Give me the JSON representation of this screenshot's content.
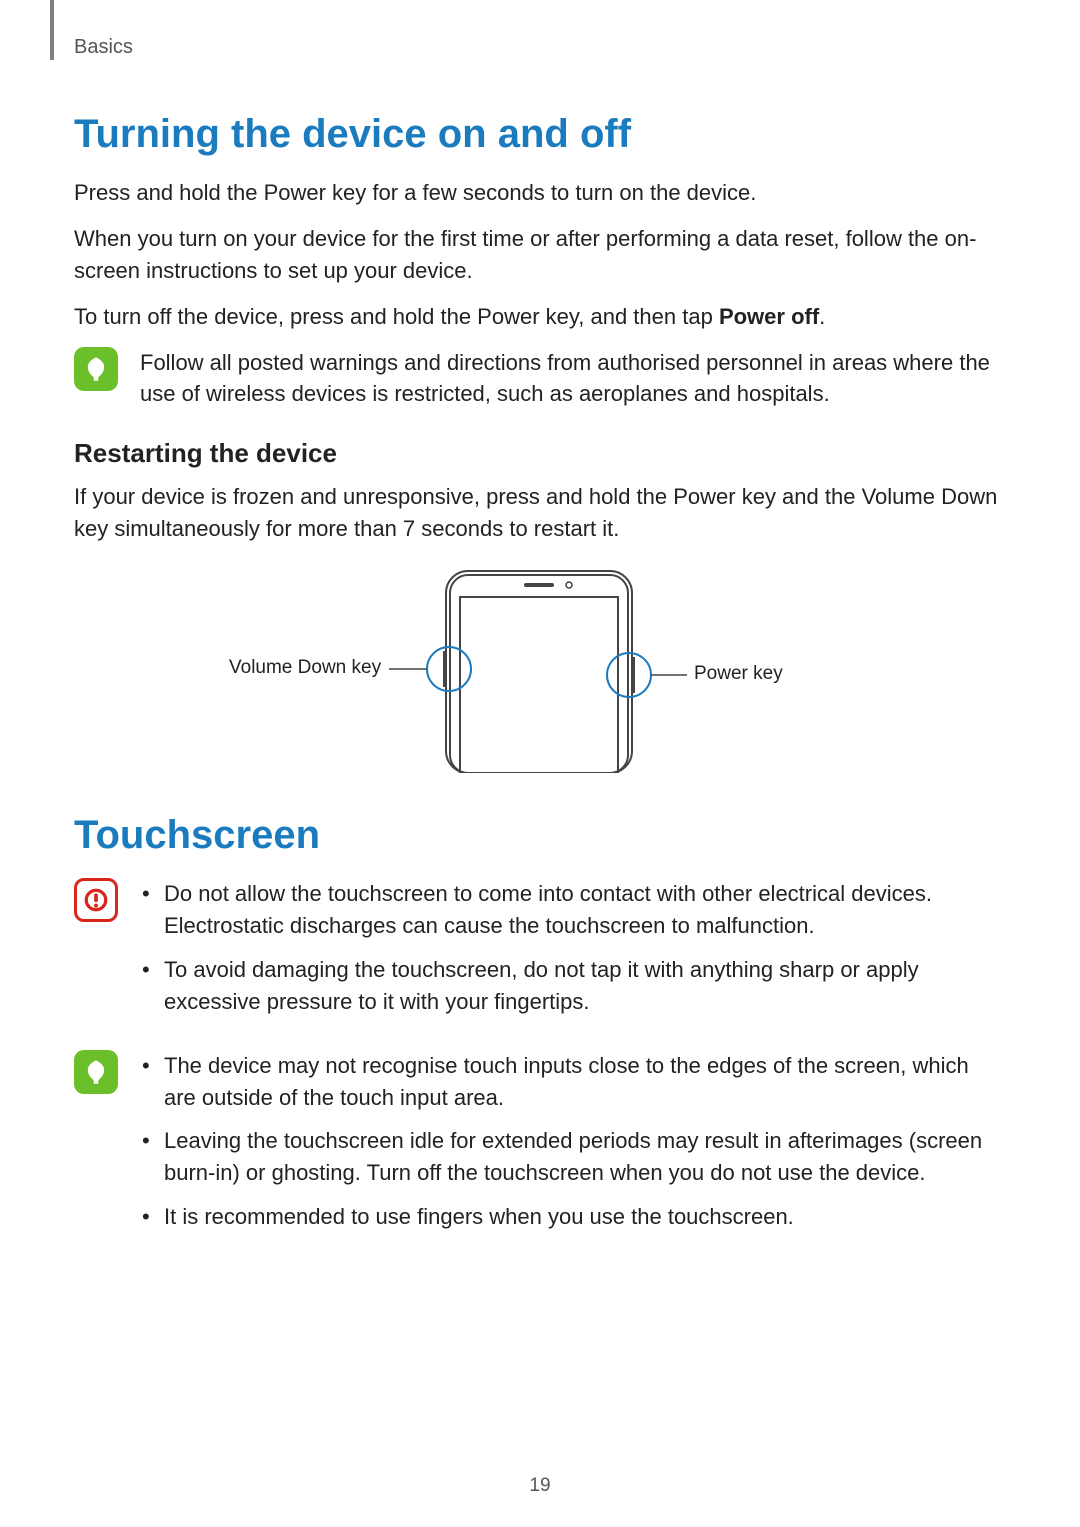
{
  "breadcrumb": "Basics",
  "section1": {
    "heading": "Turning the device on and off",
    "p1": "Press and hold the Power key for a few seconds to turn on the device.",
    "p2": "When you turn on your device for the first time or after performing a data reset, follow the on-screen instructions to set up your device.",
    "p3a": "To turn off the device, press and hold the Power key, and then tap ",
    "p3b_bold": "Power off",
    "p3c": ".",
    "note": "Follow all posted warnings and directions from authorised personnel in areas where the use of wireless devices is restricted, such as aeroplanes and hospitals.",
    "sub_heading": "Restarting the device",
    "sub_p": "If your device is frozen and unresponsive, press and hold the Power key and the Volume Down key simultaneously for more than 7 seconds to restart it."
  },
  "diagram": {
    "label_left": "Volume Down key",
    "label_right": "Power key"
  },
  "section2": {
    "heading": "Touchscreen",
    "caution": {
      "b1": "Do not allow the touchscreen to come into contact with other electrical devices. Electrostatic discharges can cause the touchscreen to malfunction.",
      "b2": "To avoid damaging the touchscreen, do not tap it with anything sharp or apply excessive pressure to it with your fingertips."
    },
    "note": {
      "b1": "The device may not recognise touch inputs close to the edges of the screen, which are outside of the touch input area.",
      "b2": "Leaving the touchscreen idle for extended periods may result in afterimages (screen burn-in) or ghosting. Turn off the touchscreen when you do not use the device.",
      "b3": "It is recommended to use fingers when you use the touchscreen."
    }
  },
  "page_number": "19"
}
